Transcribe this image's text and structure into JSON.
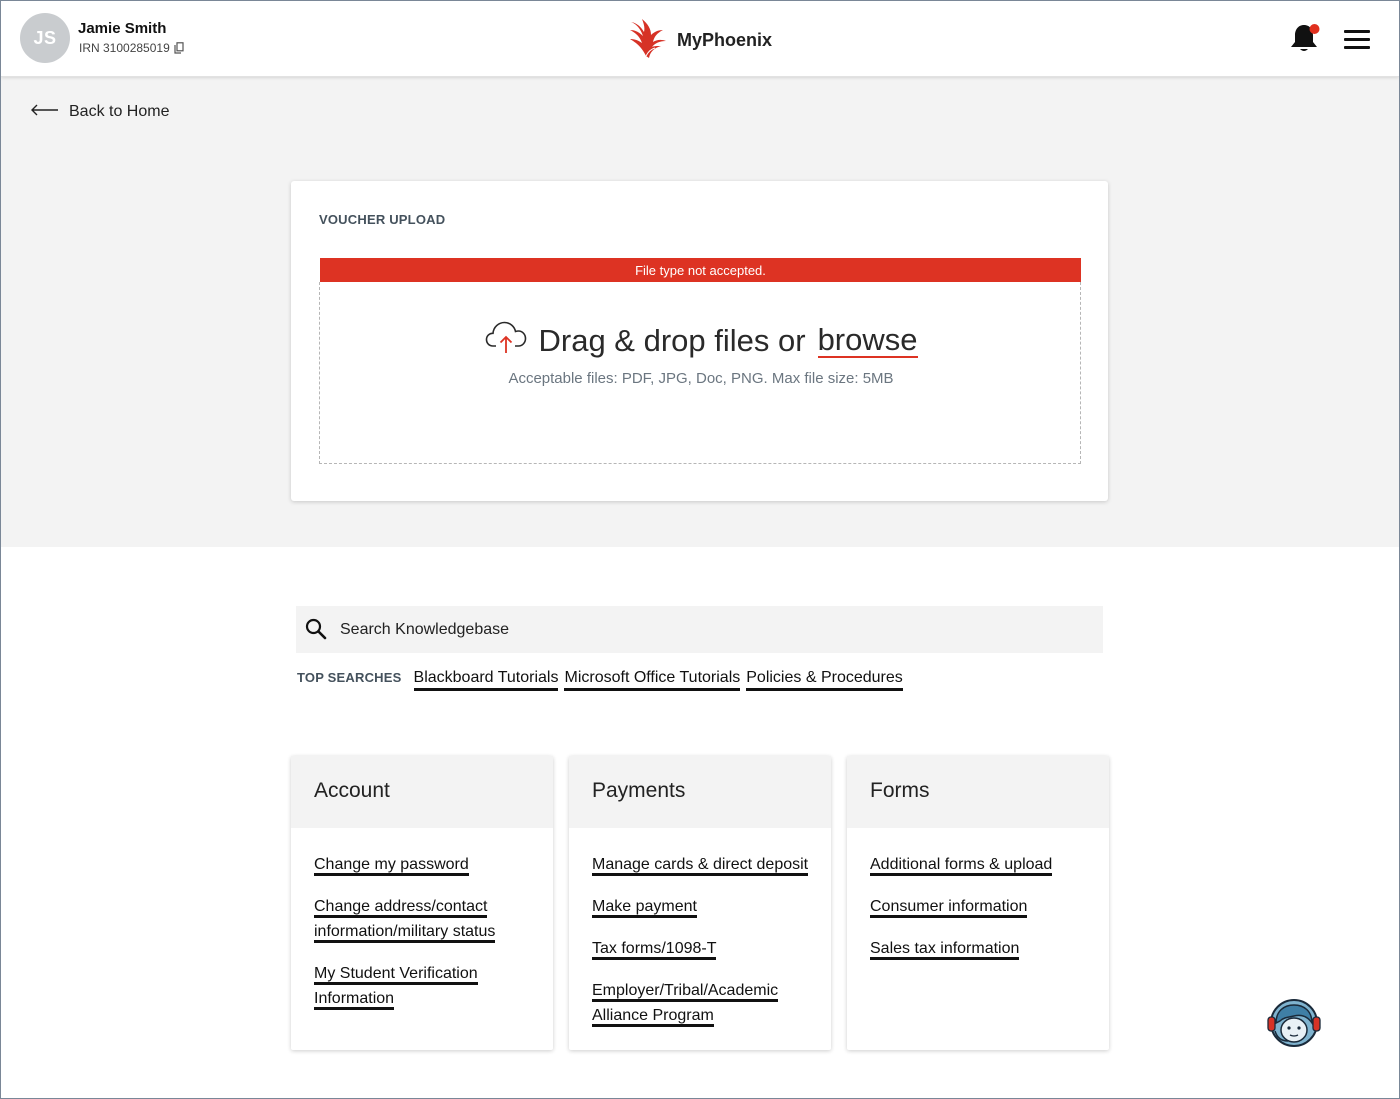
{
  "header": {
    "avatar_initials": "JS",
    "user_name": "Jamie Smith",
    "irn": "IRN 3100285019",
    "brand": "MyPhoenix",
    "notification_dot_color": "#e0301e",
    "accent_color": "#dd3323"
  },
  "nav": {
    "back_label": "Back to Home"
  },
  "upload": {
    "title": "VOUCHER UPLOAD",
    "error": "File type not accepted.",
    "drop_text": "Drag & drop files or",
    "browse_label": "browse",
    "hint": "Acceptable files: PDF, JPG, Doc, PNG. Max file size: 5MB"
  },
  "search": {
    "placeholder": "Search Knowledgebase",
    "top_label": "TOP SEARCHES",
    "top_links": [
      "Blackboard Tutorials",
      "Microsoft Office Tutorials",
      "Policies & Procedures"
    ]
  },
  "cards": {
    "account": {
      "title": "Account",
      "links": [
        [
          "Change my password"
        ],
        [
          "Change address/contact",
          "information/military status"
        ],
        [
          "My Student Verification",
          "Information"
        ]
      ]
    },
    "payments": {
      "title": "Payments",
      "links": [
        [
          "Manage cards & direct deposit"
        ],
        [
          "Make payment"
        ],
        [
          "Tax forms/1098-T"
        ],
        [
          "Employer/Tribal/Academic",
          "Alliance Program"
        ]
      ]
    },
    "forms": {
      "title": "Forms",
      "links": [
        [
          "Additional forms & upload"
        ],
        [
          "Consumer information"
        ],
        [
          "Sales tax information"
        ]
      ]
    }
  }
}
